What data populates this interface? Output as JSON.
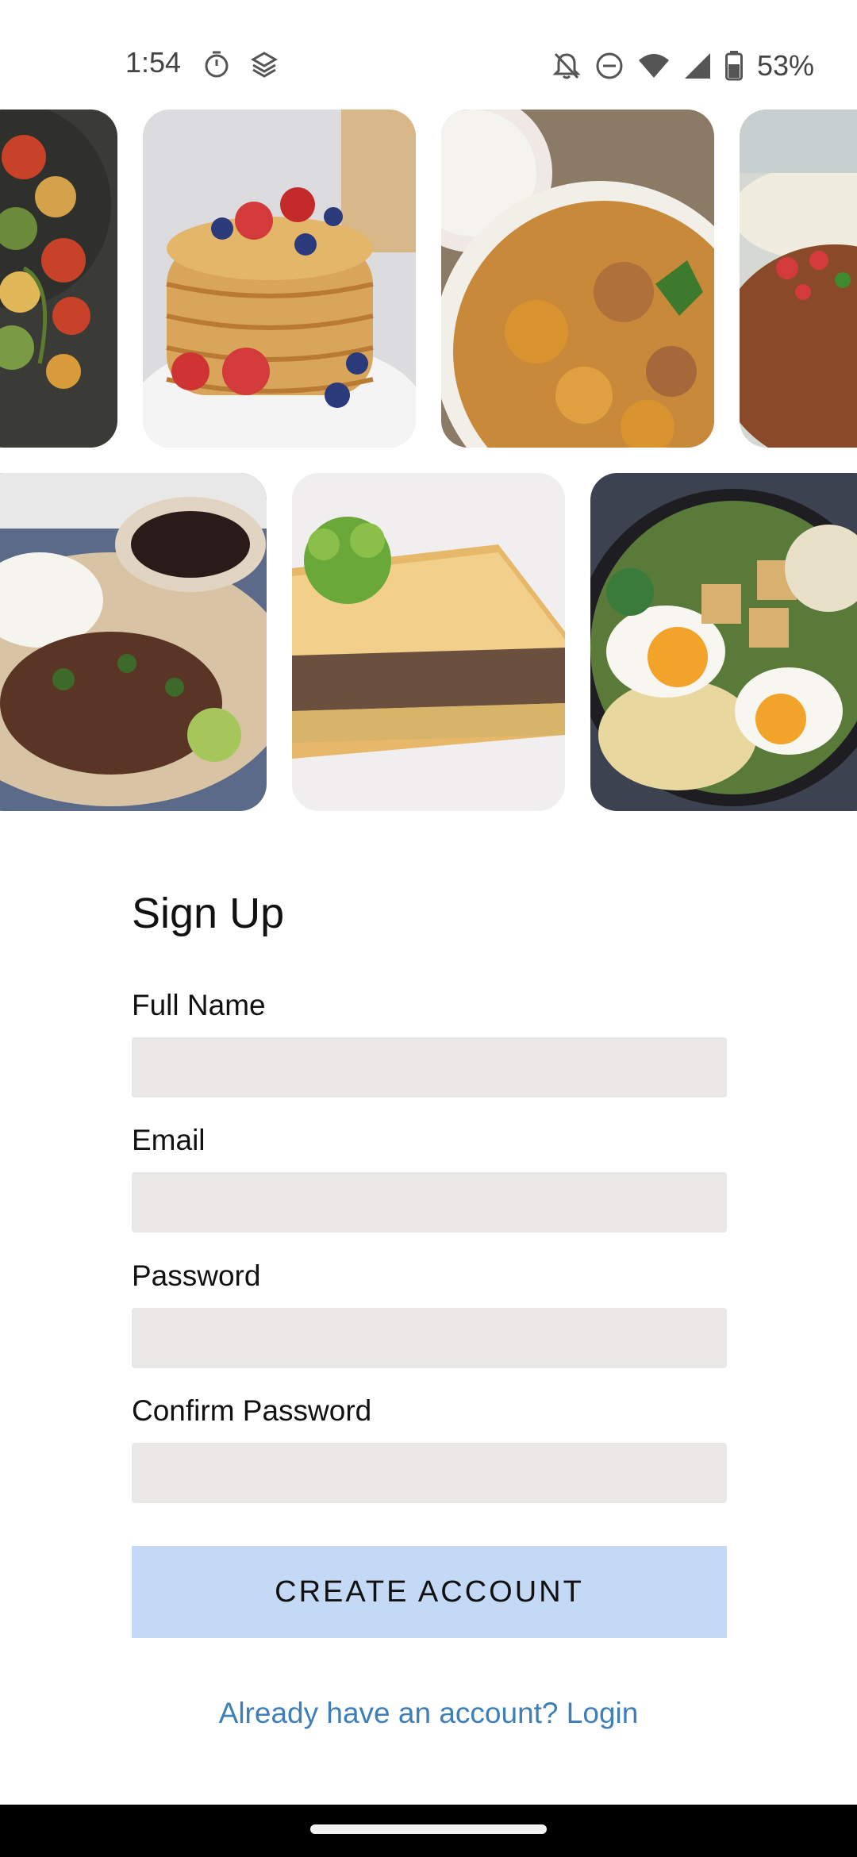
{
  "status_bar": {
    "time": "1:54",
    "battery_percent": "53%",
    "icons": [
      "stopwatch-icon",
      "stack-icon",
      "notifications-off-icon",
      "do-not-disturb-icon",
      "wifi-icon",
      "signal-icon",
      "battery-icon"
    ]
  },
  "gallery": {
    "row1": [
      "ratatouille",
      "pancakes",
      "curry",
      "taco-meat"
    ],
    "row2": [
      "pulled-pork-plate",
      "moussaka",
      "ramen"
    ]
  },
  "form": {
    "title": "Sign Up",
    "full_name_label": "Full Name",
    "email_label": "Email",
    "password_label": "Password",
    "confirm_password_label": "Confirm Password",
    "full_name_value": "",
    "email_value": "",
    "password_value": "",
    "confirm_password_value": ""
  },
  "actions": {
    "create_account": "CREATE ACCOUNT",
    "login_link": "Already have an account? Login"
  },
  "colors": {
    "field_bg": "#e9e8e6",
    "button_bg": "#c3d9f6",
    "link": "#3f7fb8"
  }
}
